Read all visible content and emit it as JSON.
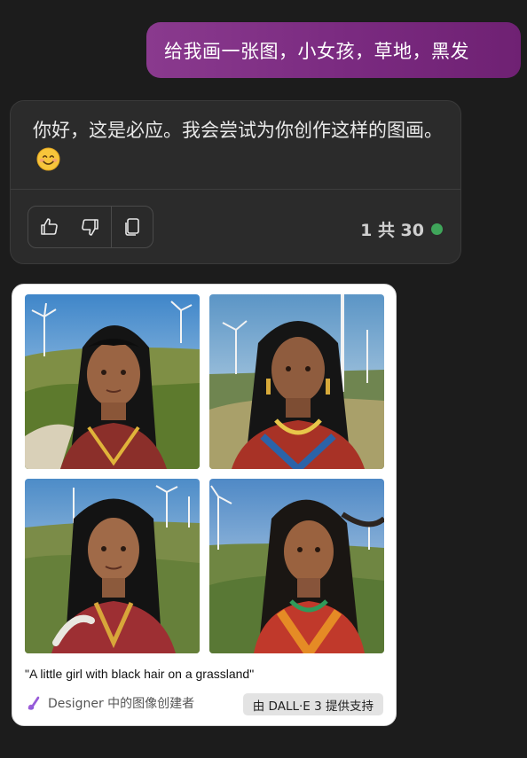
{
  "user_message": {
    "text": "给我画一张图，小女孩，草地，黑发"
  },
  "bot_message": {
    "text": "你好，这是必应。我会尝试为你创作这样的图画。",
    "emoji": "smiling-face-icon",
    "actions": [
      {
        "name": "thumbs-up-icon"
      },
      {
        "name": "thumbs-down-icon"
      },
      {
        "name": "copy-icon"
      }
    ],
    "counter": "1 共 30",
    "status_color": "#3fa55a"
  },
  "image_result": {
    "caption": "\"A little girl with black hair on a grassland\"",
    "designer_label": "Designer 中的图像创建者",
    "provider_badge": "由 DALL·E 3 提供支持",
    "images": [
      {
        "alt": "girl with black hair on grassland with wind turbines"
      },
      {
        "alt": "girl with black hair and beaded necklace near wind turbines"
      },
      {
        "alt": "smiling girl with long black hair on green hills"
      },
      {
        "alt": "girl with windblown black hair on grassy hillside"
      }
    ]
  },
  "colors": {
    "background": "#1c1c1c",
    "user_bubble": "#7a2a80",
    "bot_card": "#2b2b2b",
    "image_card": "#ffffff"
  }
}
